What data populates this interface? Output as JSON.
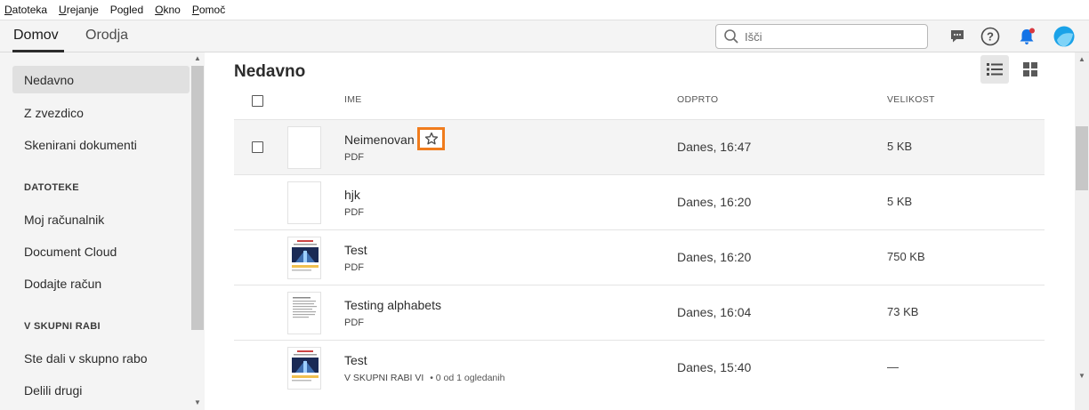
{
  "menu": {
    "items": [
      {
        "first": "D",
        "rest": "atoteka"
      },
      {
        "first": "U",
        "rest": "rejanje"
      },
      {
        "first": "",
        "rest": "Pogled"
      },
      {
        "first": "O",
        "rest": "kno"
      },
      {
        "first": "P",
        "rest": "omoč"
      }
    ]
  },
  "topbar": {
    "tabs": [
      "Domov",
      "Orodja"
    ],
    "search_placeholder": "Išči",
    "icons": [
      "chat-icon",
      "help-icon",
      "bell-icon",
      "profile-icon"
    ],
    "accent": "#1473e6",
    "notification_color": "#d7373f"
  },
  "sidebar": {
    "items": [
      "Nedavno",
      "Z zvezdico",
      "Skenirani dokumenti"
    ],
    "section_files": "DATOTEKE",
    "files_items": [
      "Moj računalnik",
      "Document Cloud",
      "Dodajte račun"
    ],
    "section_shared": "V SKUPNI RABI",
    "shared_items": [
      "Ste dali v skupno rabo",
      "Delili drugi"
    ]
  },
  "main": {
    "title": "Nedavno",
    "columns": {
      "name": "IME",
      "opened": "ODPRTO",
      "size": "VELIKOST"
    },
    "rows": [
      {
        "name": "Neimenovan",
        "type": "PDF",
        "opened": "Danes, 16:47",
        "size": "5 KB",
        "thumb": "blank"
      },
      {
        "name": "hjk",
        "type": "PDF",
        "opened": "Danes, 16:20",
        "size": "5 KB",
        "thumb": "blank"
      },
      {
        "name": "Test",
        "type": "PDF",
        "opened": "Danes, 16:20",
        "size": "750 KB",
        "thumb": "image"
      },
      {
        "name": "Testing alphabets",
        "type": "PDF",
        "opened": "Danes, 16:04",
        "size": "73 KB",
        "thumb": "text"
      },
      {
        "name": "Test",
        "type": "V SKUPNI RABI VI",
        "shared_note": "• 0 od 1 ogledanih",
        "opened": "Danes, 15:40",
        "size": "—",
        "thumb": "image"
      }
    ],
    "highlight_color": "#f07c1d"
  }
}
